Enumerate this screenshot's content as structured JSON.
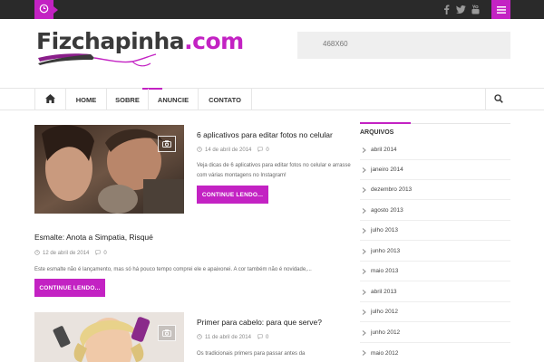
{
  "topbar": {
    "clock_icon": "clock-icon",
    "social_icons": [
      "facebook-icon",
      "twitter-icon",
      "youtube-icon"
    ],
    "menu_icon": "hamburger-menu-icon"
  },
  "header": {
    "logo_dark": "Fizchapinha",
    "logo_pink": ".com",
    "ad_label": "468X60"
  },
  "nav": {
    "home_icon": "home-icon",
    "items": [
      "HOME",
      "SOBRE",
      "ANUNCIE",
      "CONTATO"
    ],
    "active": "HOME",
    "search_icon": "search-icon"
  },
  "posts": [
    {
      "title": "6 aplicativos para editar fotos no celular",
      "date": "14 de abril de 2014",
      "comments": "0",
      "excerpt": "Veja dicas de 6 aplicativos para editar fotos no celular e arrasse com várias montagens no Instagram!",
      "button": "CONTINUE LENDO...",
      "has_photo": true
    },
    {
      "title": "Esmalte: Anota a Simpatia, Risqué",
      "date": "12 de abril de 2014",
      "comments": "0",
      "excerpt": "Este esmalte não é lançamento, mas só há pouco tempo comprei ele e apaixonei. A cor também não é novidade,...",
      "button": "CONTINUE LENDO...",
      "has_photo": false
    },
    {
      "title": "Primer para cabelo: para que serve?",
      "date": "11 de abril de 2014",
      "comments": "0",
      "excerpt": "Os tradicionais primers para passar antes da",
      "has_photo": true
    }
  ],
  "sidebar": {
    "title": "ARQUIVOS",
    "archives": [
      "abril 2014",
      "janeiro 2014",
      "dezembro 2013",
      "agosto 2013",
      "julho 2013",
      "junho 2013",
      "maio 2013",
      "abril 2013",
      "julho 2012",
      "junho 2012",
      "maio 2012"
    ]
  },
  "colors": {
    "accent": "#c322c3",
    "topbar": "#2a2a2a",
    "text_dark": "#222222"
  }
}
